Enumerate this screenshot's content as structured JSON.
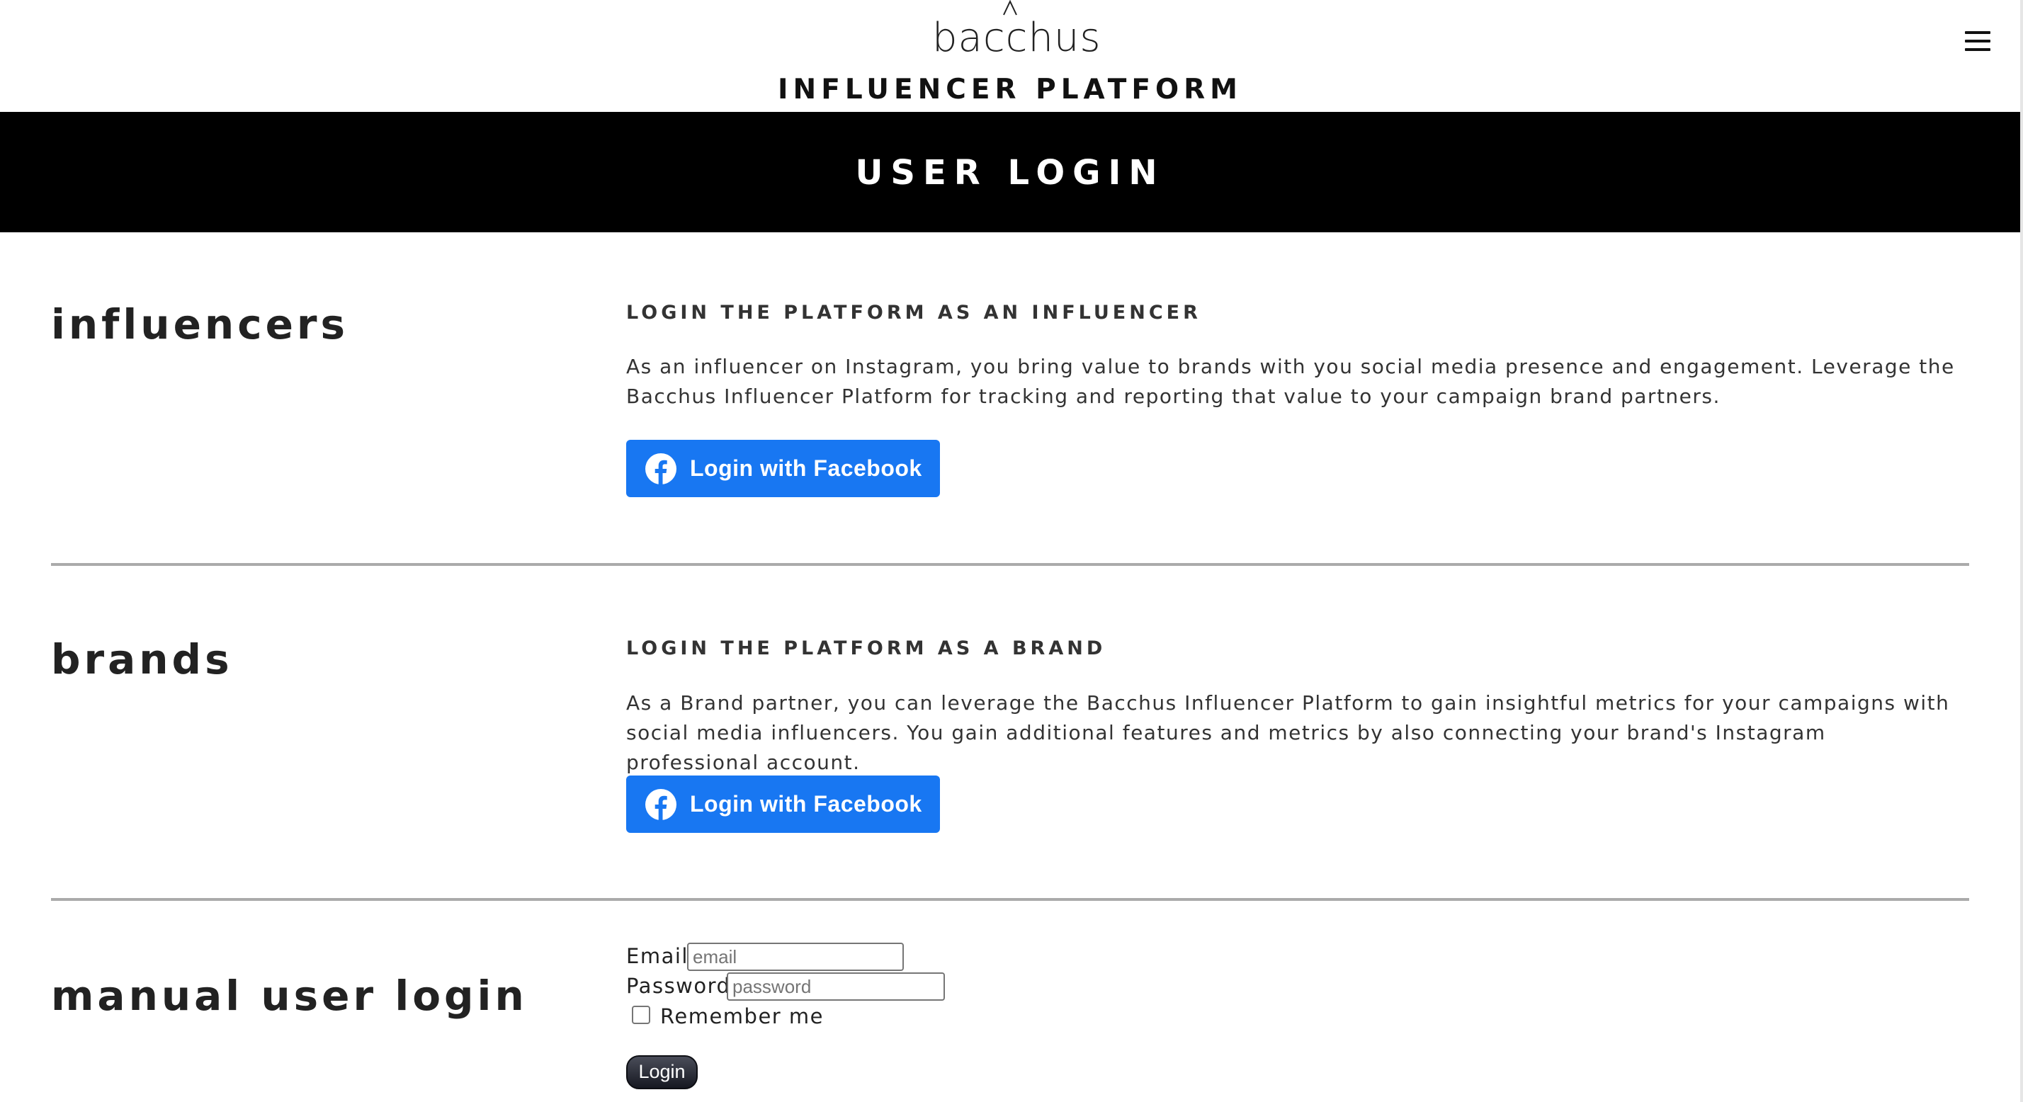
{
  "header": {
    "logo_text": "bacchus",
    "platform_title": "INFLUENCER PLATFORM",
    "menu_icon": "hamburger-menu-icon"
  },
  "banner": {
    "title": "USER LOGIN"
  },
  "sections": {
    "influencers": {
      "heading": "influencers",
      "sub_heading": "LOGIN THE PLATFORM AS AN INFLUENCER",
      "description": "As an influencer on Instagram, you bring value to brands with you social media presence and engagement. Leverage the Bacchus Influencer Platform for tracking and reporting that value to your campaign brand partners.",
      "button_label": "Login with Facebook",
      "button_icon": "facebook-icon"
    },
    "brands": {
      "heading": "brands",
      "sub_heading": "LOGIN THE PLATFORM AS A BRAND",
      "description": "As a Brand partner, you can leverage the Bacchus Influencer Platform to gain insightful metrics for your campaigns with social media influencers. You gain additional features and metrics by also connecting your brand's Instagram professional account.",
      "button_label": "Login with Facebook",
      "button_icon": "facebook-icon"
    },
    "manual": {
      "heading": "manual user login",
      "email_label": "Email",
      "email_placeholder": "email",
      "password_label": "Password",
      "password_placeholder": "password",
      "remember_label": "Remember me",
      "login_label": "Login"
    }
  },
  "colors": {
    "facebook_blue": "#1877f2",
    "banner_bg": "#000000",
    "divider": "#aaaaaa"
  }
}
